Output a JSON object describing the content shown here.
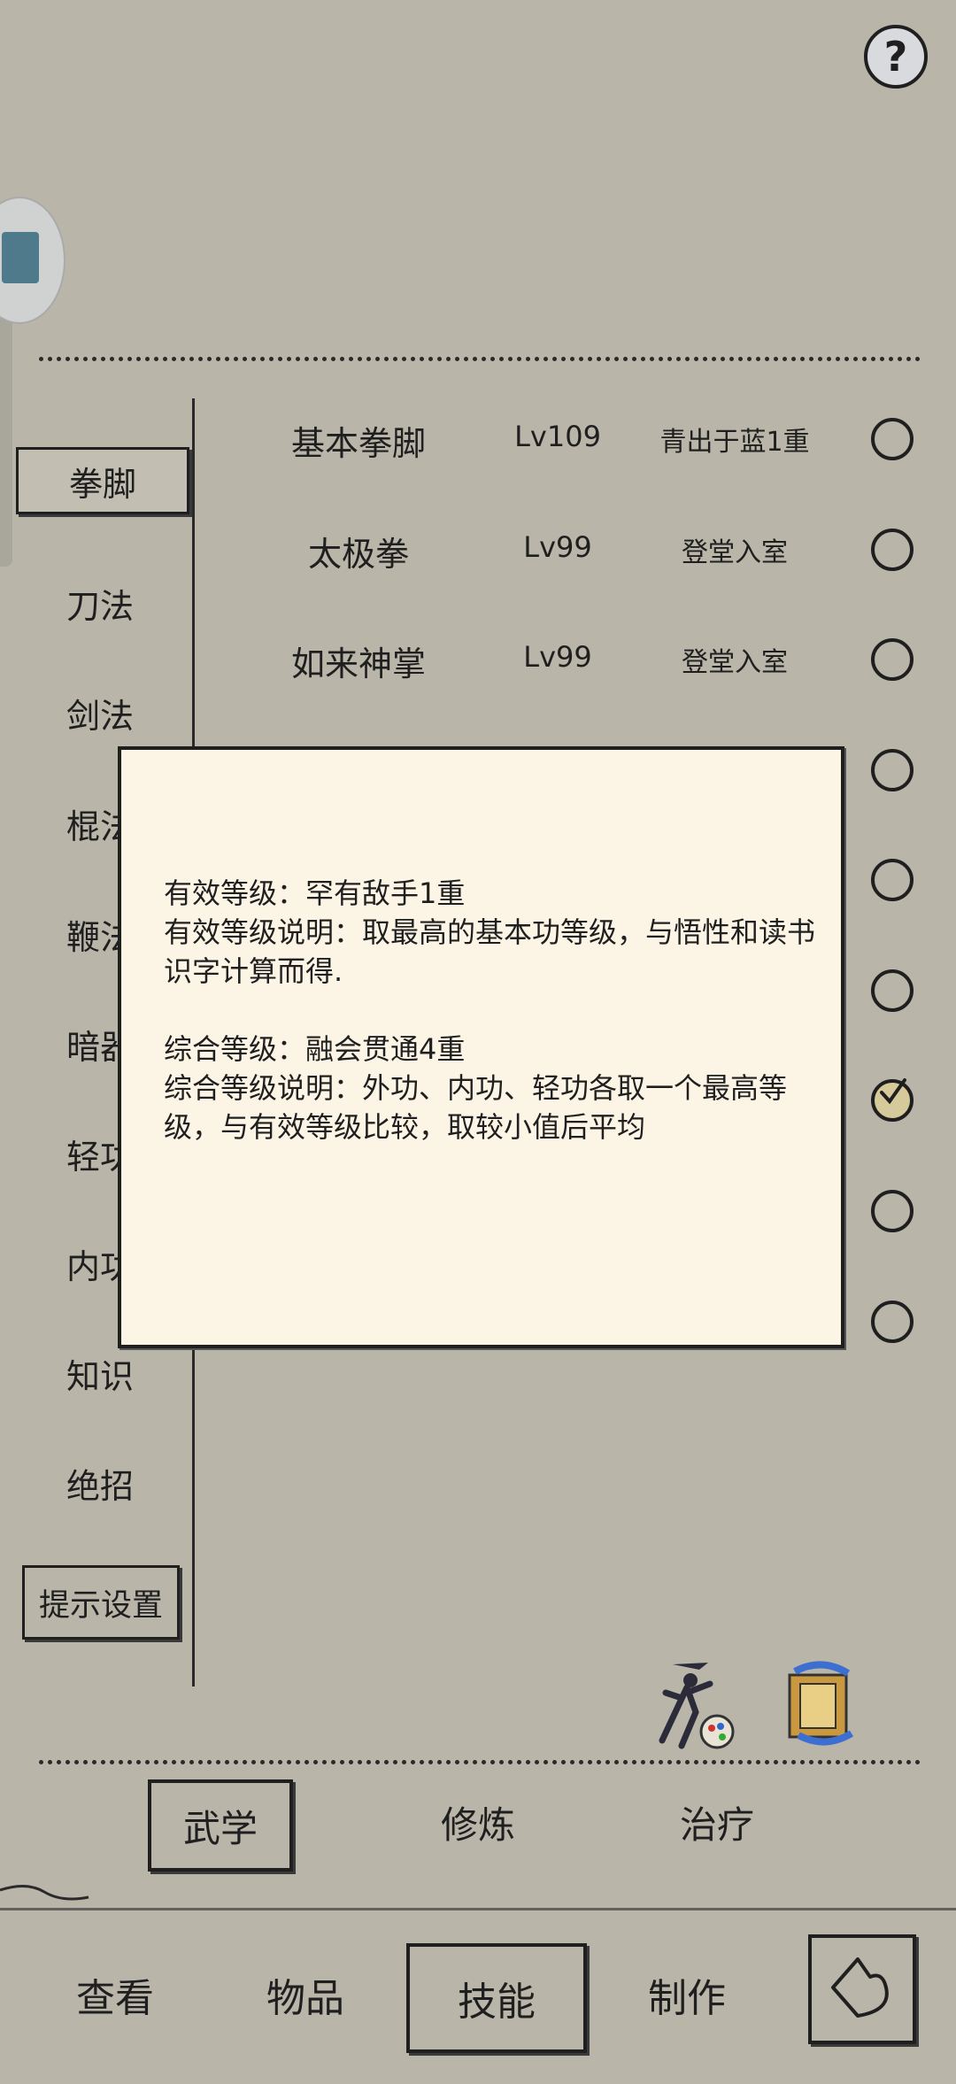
{
  "help": {
    "label": "?"
  },
  "categories": {
    "items": [
      {
        "label": "拳脚",
        "active": true
      },
      {
        "label": "刀法"
      },
      {
        "label": "剑法"
      },
      {
        "label": "棍法"
      },
      {
        "label": "鞭法"
      },
      {
        "label": "暗器"
      },
      {
        "label": "轻功"
      },
      {
        "label": "内功"
      },
      {
        "label": "知识"
      },
      {
        "label": "绝招"
      }
    ],
    "hint_settings": "提示设置"
  },
  "skills": [
    {
      "name": "基本拳脚",
      "level": "Lv109",
      "status": "青出于蓝1重",
      "checked": false
    },
    {
      "name": "太极拳",
      "level": "Lv99",
      "status": "登堂入室",
      "checked": false
    },
    {
      "name": "如来神掌",
      "level": "Lv99",
      "status": "登堂入室",
      "checked": false
    }
  ],
  "radio_states": [
    false,
    false,
    false,
    false,
    false,
    false,
    true,
    false,
    false
  ],
  "dialog": {
    "text": "有效等级：罕有敌手1重\n有效等级说明：取最高的基本功等级，与悟性和读书识字计算而得.\n\n综合等级：融会贯通4重\n综合等级说明：外功、内功、轻功各取一个最高等级，与有效等级比较，取较小值后平均"
  },
  "subtabs": [
    {
      "label": "武学",
      "active": true
    },
    {
      "label": "修炼"
    },
    {
      "label": "治疗"
    }
  ],
  "nav": [
    {
      "label": "查看"
    },
    {
      "label": "物品"
    },
    {
      "label": "技能",
      "active": true
    },
    {
      "label": "制作"
    }
  ],
  "icons": {
    "help": "question-icon",
    "fighter": "martial-artist-icon",
    "scroll": "scroll-swap-icon",
    "back": "back-arrow-icon"
  }
}
